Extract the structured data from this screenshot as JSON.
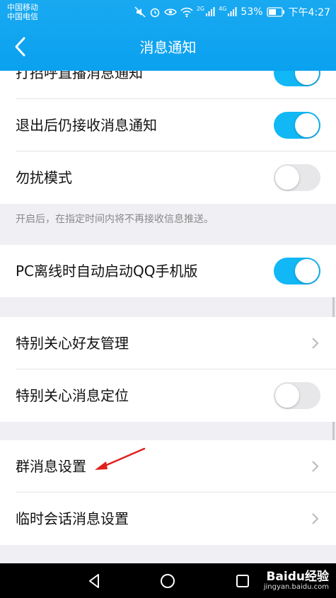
{
  "status_bar": {
    "carrier1": "中国移动",
    "carrier2": "中国电信",
    "battery": "53%",
    "time": "下午4:27",
    "net1": "2G",
    "net2": "4G"
  },
  "header": {
    "title": "消息通知"
  },
  "rows": [
    {
      "label": "打招呼直播消息通知",
      "toggle": "on"
    },
    {
      "label": "退出后仍接收消息通知",
      "toggle": "on"
    },
    {
      "label": "勿扰模式",
      "toggle": "off"
    },
    {
      "label": "PC离线时自动启动QQ手机版",
      "toggle": "on"
    },
    {
      "label": "特别关心好友管理",
      "control": "chevron"
    },
    {
      "label": "特别关心消息定位",
      "toggle": "off"
    },
    {
      "label": "群消息设置",
      "control": "chevron"
    },
    {
      "label": "临时会话消息设置",
      "control": "chevron"
    }
  ],
  "hint": "开启后，在指定时间内将不再接收信息推送。",
  "watermark": {
    "brand": "Baidu经验",
    "url": "jingyan.baidu.com"
  },
  "colors": {
    "accent": "#12b7f5",
    "header": "#0aa1ef",
    "background": "#efeff4",
    "annotation_arrow": "#e0201c"
  }
}
